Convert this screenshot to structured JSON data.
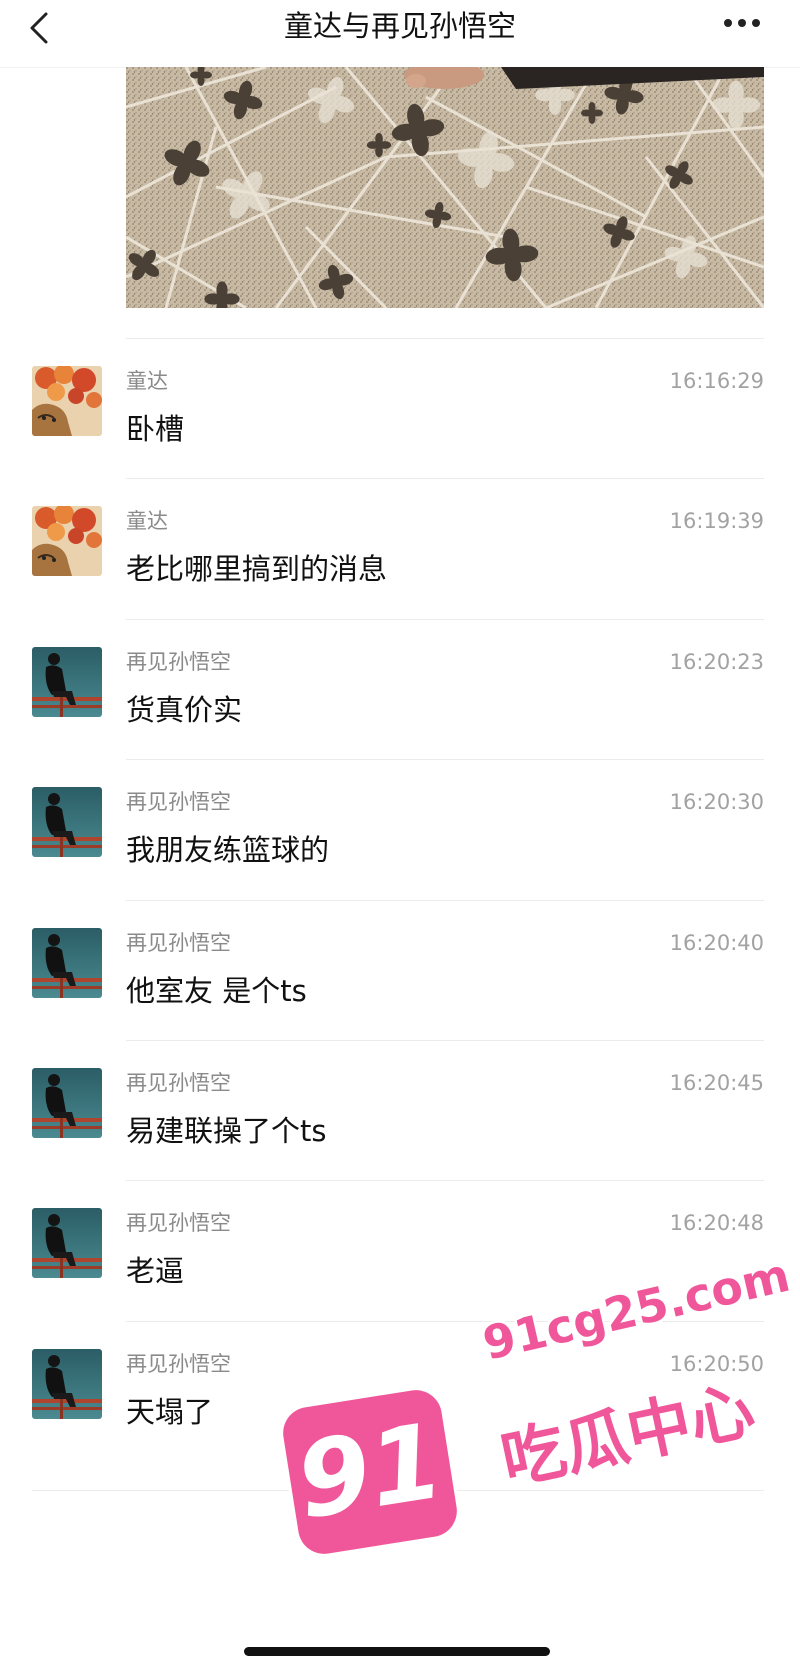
{
  "header": {
    "title": "童达与再见孙悟空",
    "back_icon": "chevron-left-icon",
    "more_icon": "more-horizontal-icon"
  },
  "shared_photo": {
    "icon": "carpet-photo"
  },
  "messages": [
    {
      "sender": "童达",
      "time": "16:16:29",
      "text": "卧槽",
      "avatar": "tongda"
    },
    {
      "sender": "童达",
      "time": "16:19:39",
      "text": "老比哪里搞到的消息",
      "avatar": "tongda"
    },
    {
      "sender": "再见孙悟空",
      "time": "16:20:23",
      "text": "货真价实",
      "avatar": "wukong"
    },
    {
      "sender": "再见孙悟空",
      "time": "16:20:30",
      "text": "我朋友练篮球的",
      "avatar": "wukong"
    },
    {
      "sender": "再见孙悟空",
      "time": "16:20:40",
      "text": "他室友 是个ts",
      "avatar": "wukong"
    },
    {
      "sender": "再见孙悟空",
      "time": "16:20:45",
      "text": "易建联操了个ts",
      "avatar": "wukong"
    },
    {
      "sender": "再见孙悟空",
      "time": "16:20:48",
      "text": "老逼",
      "avatar": "wukong"
    },
    {
      "sender": "再见孙悟空",
      "time": "16:20:50",
      "text": "天塌了",
      "avatar": "wukong"
    }
  ],
  "watermark": {
    "badge": "91",
    "domain": "91cg25.com",
    "name": "吃瓜中心"
  },
  "colors": {
    "text_primary": "#111111",
    "text_secondary": "#8a8a8a",
    "separator": "#ececec",
    "watermark_pink": "#f0579a"
  }
}
